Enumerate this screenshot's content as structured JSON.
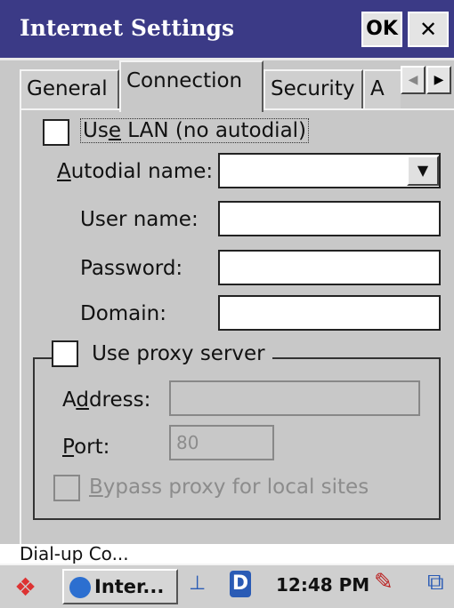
{
  "window": {
    "title": "Internet Settings",
    "ok_label": "OK",
    "close_label": "✕"
  },
  "tabs": [
    {
      "label": "General"
    },
    {
      "label": "Connection"
    },
    {
      "label": "Security"
    },
    {
      "label": "A"
    }
  ],
  "tab_scroll": {
    "left": "◀",
    "right": "▶"
  },
  "connection": {
    "use_lan_label_pre": "Us",
    "use_lan_label_u": "e",
    "use_lan_label_post": " LAN (no autodial)",
    "use_lan_checked": false,
    "autodial_label_u": "A",
    "autodial_label_post": "utodial name:",
    "autodial_value": "",
    "dropdown_icon": "▼",
    "username_label": "User name:",
    "username_value": "",
    "password_label": "Password:",
    "password_value": "",
    "domain_label": "Domain:",
    "domain_value": "",
    "proxy_label": "Use proxy server",
    "proxy_checked": false,
    "address_label_pre": "A",
    "address_label_u": "d",
    "address_label_post": "dress:",
    "address_value": "",
    "port_label_u": "P",
    "port_label_post": "ort:",
    "port_value": "80",
    "bypass_label_u": "B",
    "bypass_label_post": "ypass proxy for local sites",
    "bypass_checked": false
  },
  "status_strip": {
    "text": "Dial-up Co..."
  },
  "taskbar": {
    "start_icon": "start-flag-icon",
    "task_label": "Inter...",
    "clock": "12:48 PM",
    "d_label": "D",
    "net_glyph": "⊥",
    "kbd_glyph": "✎",
    "desk_glyph": "⧉"
  }
}
